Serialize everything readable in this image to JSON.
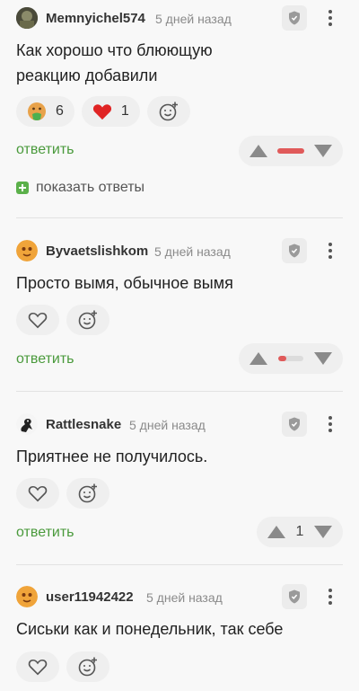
{
  "comments": [
    {
      "username": "Memnyichel574",
      "time": "5 дней назад",
      "text_lines": [
        "Как хорошо что блюющую",
        "реакцию добавили"
      ],
      "reactions": [
        {
          "icon": "vomit-emoji-icon",
          "count": "6"
        },
        {
          "icon": "heart-icon",
          "count": "1"
        }
      ],
      "reply_label": "ответить",
      "show_replies_label": "показать ответы",
      "rating_bar": "negative"
    },
    {
      "username": "Byvaetslishkom",
      "time": "5 дней назад",
      "text_lines": [
        "Просто вымя, обычное вымя"
      ],
      "reply_label": "ответить",
      "rating_bar": "mixed"
    },
    {
      "username": "Rattlesnake",
      "time": "5 дней назад",
      "text_lines": [
        "Приятнее не получилось."
      ],
      "reply_label": "ответить",
      "rating": "1"
    },
    {
      "username": "user11942422",
      "time": "5 дней назад",
      "text_lines": [
        "Сиськи как и понедельник, так себе"
      ]
    }
  ],
  "colors": {
    "accent_green": "#4a9a3c",
    "downvote_red": "#e05a5a",
    "background": "#f8f8f8"
  }
}
